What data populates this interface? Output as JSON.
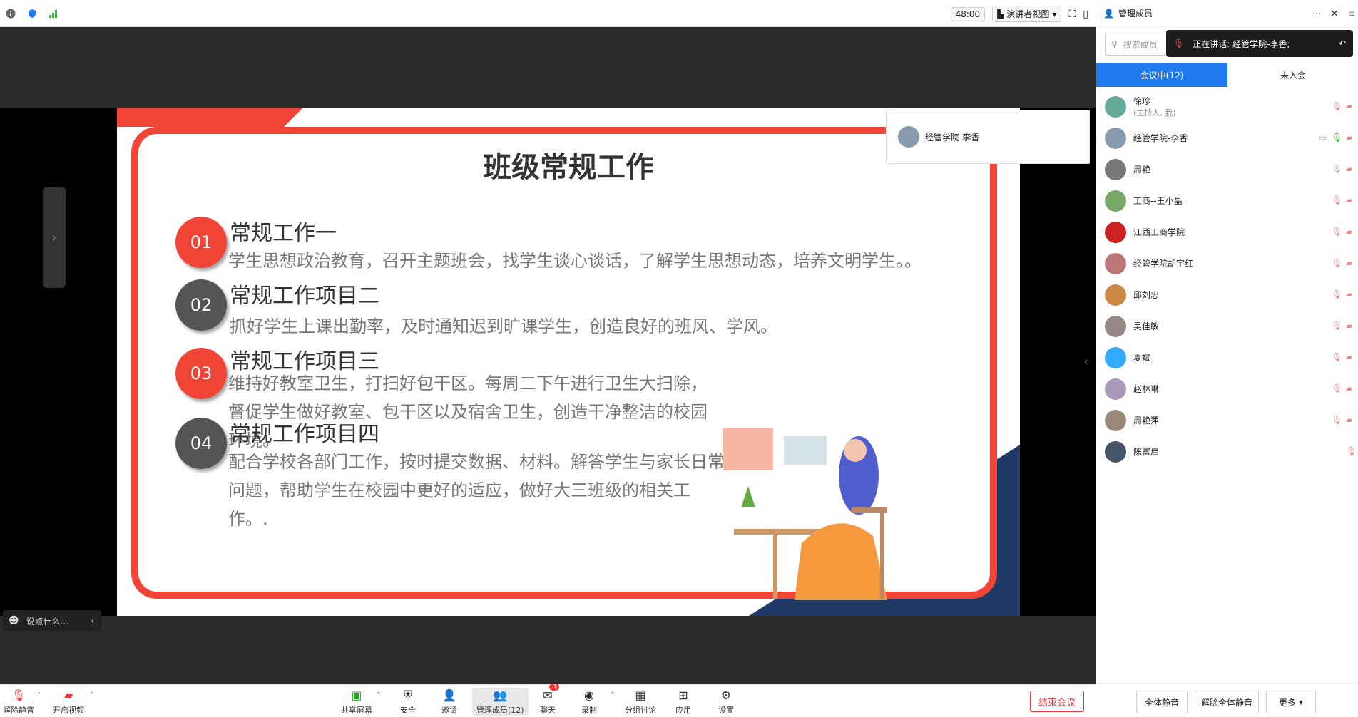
{
  "topbar": {
    "timer": "48:00",
    "view_label": "演讲者视图"
  },
  "slide": {
    "title": "班级常规工作",
    "items": [
      {
        "num": "01",
        "title": "常规工作一",
        "desc": "学生思想政治教育，召开主题班会，找学生谈心谈话，了解学生思想动态，培养文明学生。。",
        "color": "#f04436"
      },
      {
        "num": "02",
        "title": "常规工作项目二",
        "desc": "抓好学生上课出勤率，及时通知迟到旷课学生，创造良好的班风、学风。",
        "color": "#555555"
      },
      {
        "num": "03",
        "title": "常规工作项目三",
        "desc": "维持好教室卫生，打扫好包干区。每周二下午进行卫生大扫除，督促学生做好教室、包干区以及宿舍卫生，创造干净整洁的校园环境。",
        "color": "#f04436"
      },
      {
        "num": "04",
        "title": "常规工作项目四",
        "desc": "配合学校各部门工作，按时提交数据、材料。解答学生与家长日常问题，帮助学生在校园中更好的适应，做好大三班级的相关工作。.",
        "color": "#555555"
      }
    ]
  },
  "speaker": {
    "name": "经管学院-李香"
  },
  "chat": {
    "placeholder": "说点什么..."
  },
  "bottombar": {
    "unmute": "解除静音",
    "video": "开启视频",
    "share": "共享屏幕",
    "security": "安全",
    "invite": "邀请",
    "members": "管理成员(12)",
    "chat": "聊天",
    "chat_badge": "3",
    "record": "录制",
    "breakout": "分组讨论",
    "apps": "应用",
    "settings": "设置",
    "end": "结束会议"
  },
  "sidebar": {
    "title": "管理成员",
    "search_placeholder": "搜索成员",
    "talking": "正在讲话: 经管学院-李香;",
    "tab_in": "会议中(12)",
    "tab_out": "未入会",
    "participants": [
      {
        "name": "徐珍",
        "sub": "(主持人, 我)",
        "color": "#6a9"
      },
      {
        "name": "经管学院-李香",
        "sub": "",
        "color": "#889ab0"
      },
      {
        "name": "周艳",
        "sub": "",
        "color": "#777"
      },
      {
        "name": "工商--王小晶",
        "sub": "",
        "color": "#7a6"
      },
      {
        "name": "江西工商学院",
        "sub": "",
        "color": "#c22"
      },
      {
        "name": "经管学院胡宇红",
        "sub": "",
        "color": "#b77"
      },
      {
        "name": "邱刘忠",
        "sub": "",
        "color": "#c84"
      },
      {
        "name": "吴佳敏",
        "sub": "",
        "color": "#988"
      },
      {
        "name": "夏斌",
        "sub": "",
        "color": "#3af"
      },
      {
        "name": "赵林琳",
        "sub": "",
        "color": "#a9b"
      },
      {
        "name": "周艳萍",
        "sub": "",
        "color": "#987"
      },
      {
        "name": "陈富启",
        "sub": "",
        "color": "#456"
      }
    ],
    "mute_all": "全体静音",
    "unmute_all": "解除全体静音",
    "more": "更多"
  }
}
